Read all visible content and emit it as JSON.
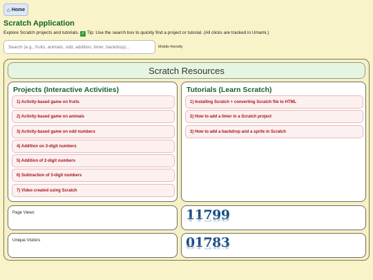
{
  "header": {
    "home_label": "Home",
    "app_title": "Scratch Application",
    "intro_before": "Explore Scratch projects and tutorials.",
    "intro_after": " Tip: Use the search box to quickly find a project or tutorial. (All clicks are tracked in Umami.)",
    "search_placeholder": "Search (e.g., fruits, animals, odd, addition, timer, backdrop)...",
    "mobile_note": "Mobile friendly"
  },
  "resources": {
    "title": "Scratch Resources",
    "projects": {
      "title": "Projects (Interactive Activities)",
      "items": [
        "1) Activity-based game on fruits",
        "2) Activity-based game on animals",
        "3) Activity-based game on odd numbers",
        "4) Addition on 3-digit numbers",
        "5) Addition of 2-digit numbers",
        "6) Subtraction of 3-digit numbers",
        "7) Video created using Scratch"
      ]
    },
    "tutorials": {
      "title": "Tutorials (Learn Scratch)",
      "items": [
        "1) Installing Scratch + converting Scratch file to HTML",
        "2) How to add a timer in a Scratch project",
        "3) How to add a backdrop and a sprite in Scratch"
      ]
    }
  },
  "stats": {
    "page_views_label": "Page Views",
    "page_views_count": "11799",
    "unique_visitors_label": "Unique Visitors",
    "unique_visitors_count": "01783"
  },
  "icons": {
    "home": "house-icon",
    "tip": "check-mark-icon"
  },
  "colors": {
    "background": "#f8f3c8",
    "title_green": "#12632a",
    "item_red": "#a4161a",
    "counter_blue": "#1b4f86"
  }
}
